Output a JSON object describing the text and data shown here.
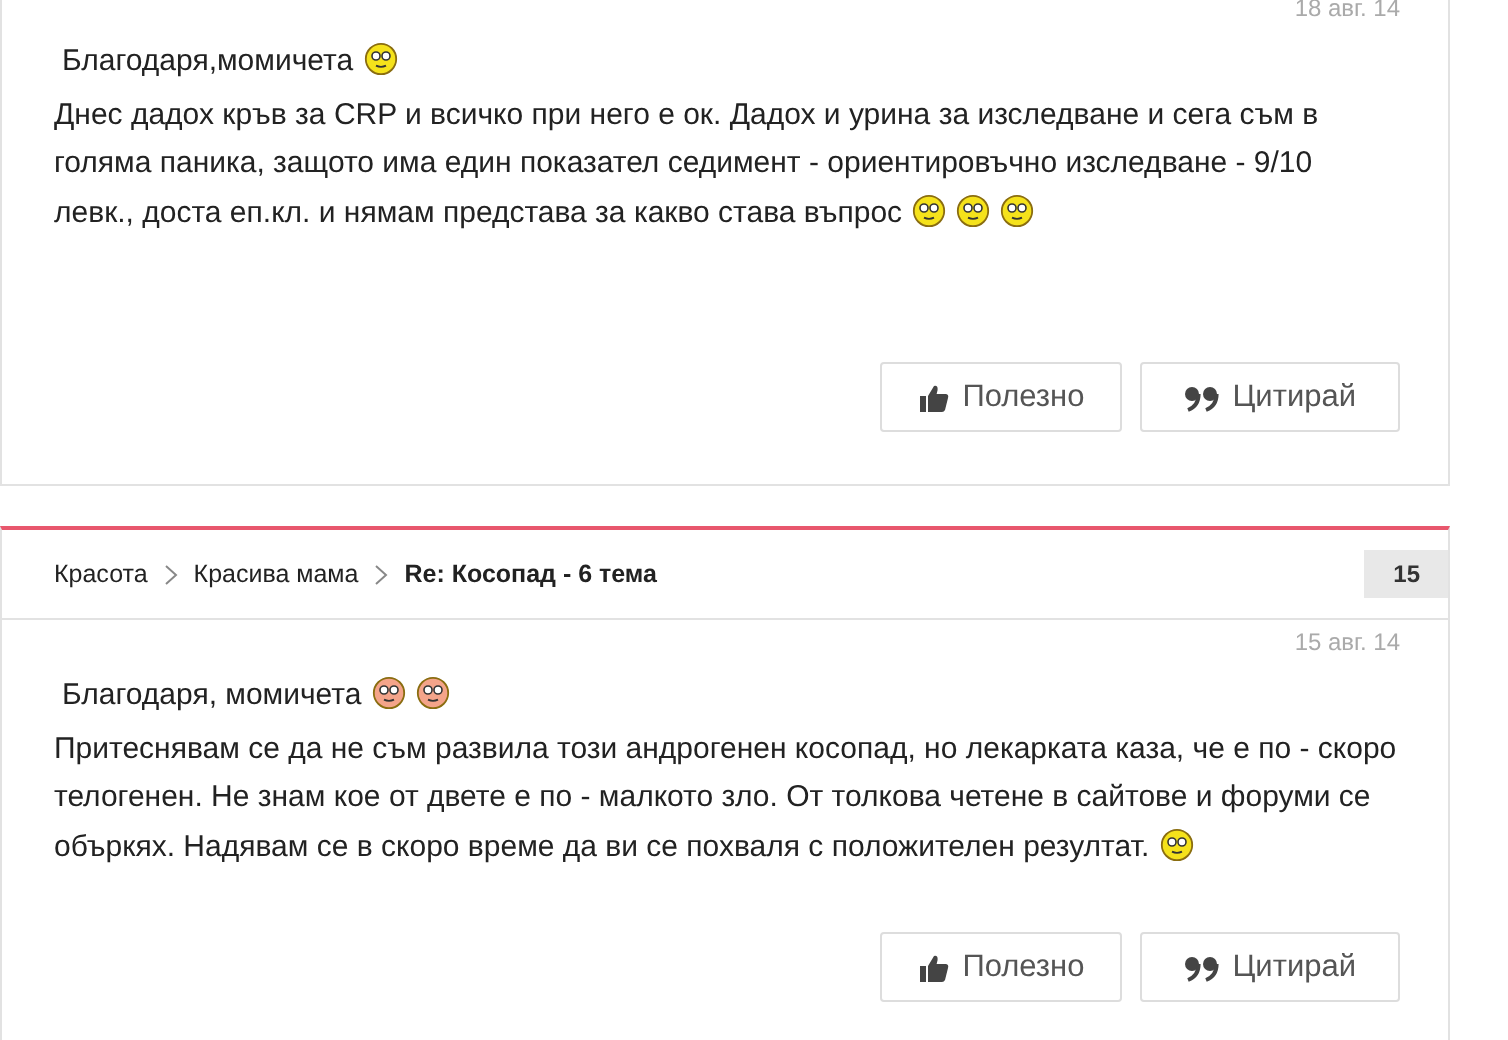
{
  "posts": [
    {
      "date": "18 авг. 14",
      "lines": [
        [
          {
            "kind": "text",
            "text": "Благодаря,момичета"
          },
          {
            "kind": "emoji",
            "color": "#f5e21b"
          }
        ],
        [
          {
            "kind": "text",
            "text": "Днес дадох кръв за CRP и всичко при него е ок. Дадох и урина за изследване и сега съм в голяма паника, защото има един показател седимент - ориентировъчно изследване - 9/10 левк., доста еп.кл. и нямам представа за какво става въпрос"
          },
          {
            "kind": "emoji",
            "color": "#f5e21b"
          },
          {
            "kind": "emoji",
            "color": "#f5e21b"
          },
          {
            "kind": "emoji",
            "color": "#f5e21b"
          }
        ]
      ],
      "buttons": [
        {
          "kind": "like",
          "label": "Полезно"
        },
        {
          "kind": "quote",
          "label": "Цитирай"
        }
      ]
    },
    {
      "breadcrumb": [
        {
          "label": "Красота",
          "current": false
        },
        {
          "label": "Красива мама",
          "current": false
        },
        {
          "label": "Re: Косопад - 6 тема",
          "current": true
        }
      ],
      "number": "15",
      "date": "15 авг. 14",
      "lines": [
        [
          {
            "kind": "text",
            "text": "Благодаря, момичета"
          },
          {
            "kind": "emoji",
            "color": "#f4a48a"
          },
          {
            "kind": "emoji",
            "color": "#f4a48a"
          }
        ],
        [
          {
            "kind": "text",
            "text": "Притеснявам се да не съм развила този андрогенен косопад, но лекарката каза, че е по - скоро телогенен. Не знам кое от двете е по - малкото зло. От толкова четене в сайтове и форуми се объркях. Надявам се в скоро време да ви се похваля с положителен резултат."
          },
          {
            "kind": "emoji",
            "color": "#f5e21b"
          }
        ]
      ],
      "buttons": [
        {
          "kind": "like",
          "label": "Полезно"
        },
        {
          "kind": "quote",
          "label": "Цитирай"
        }
      ]
    }
  ]
}
